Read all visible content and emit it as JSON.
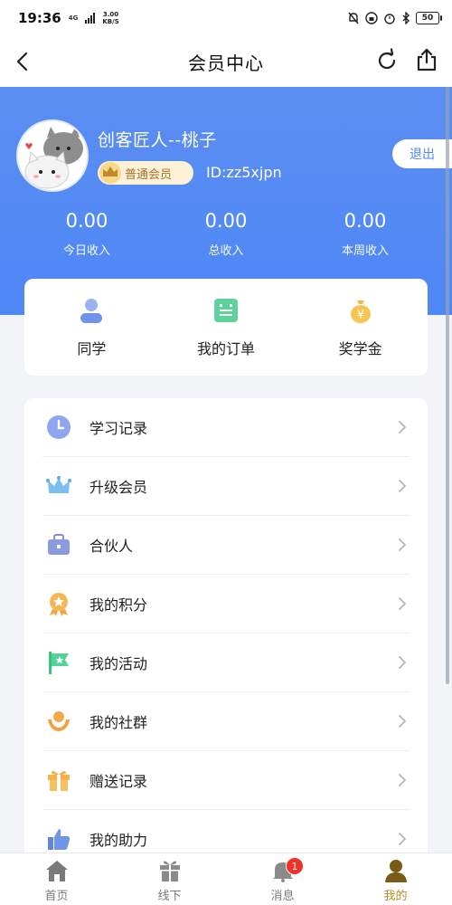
{
  "status_bar": {
    "time": "19:36",
    "network": "4G",
    "net_speed_value": "3.00",
    "net_speed_unit": "KB/S",
    "battery": "50"
  },
  "nav": {
    "title": "会员中心",
    "icons": [
      "back-icon",
      "refresh-icon",
      "share-icon"
    ]
  },
  "profile": {
    "name": "创客匠人--桃子",
    "member_level": "普通会员",
    "user_id": "ID:zz5xjpn",
    "logout_label": "退出"
  },
  "income": [
    {
      "value": "0.00",
      "label": "今日收入"
    },
    {
      "value": "0.00",
      "label": "总收入"
    },
    {
      "value": "0.00",
      "label": "本周收入"
    }
  ],
  "quick_actions": [
    {
      "label": "同学",
      "icon": "classmate-icon"
    },
    {
      "label": "我的订单",
      "icon": "order-icon"
    },
    {
      "label": "奖学金",
      "icon": "money-bag-icon"
    }
  ],
  "menu": [
    {
      "label": "学习记录",
      "icon": "clock-icon"
    },
    {
      "label": "升级会员",
      "icon": "crown-icon"
    },
    {
      "label": "合伙人",
      "icon": "briefcase-icon"
    },
    {
      "label": "我的积分",
      "icon": "medal-icon"
    },
    {
      "label": "我的活动",
      "icon": "flag-icon"
    },
    {
      "label": "我的社群",
      "icon": "community-icon"
    },
    {
      "label": "赠送记录",
      "icon": "gift-icon"
    },
    {
      "label": "我的助力",
      "icon": "thumbs-up-icon"
    }
  ],
  "tabs": [
    {
      "label": "首页",
      "icon": "home-icon"
    },
    {
      "label": "线下",
      "icon": "gift-box-icon"
    },
    {
      "label": "消息",
      "icon": "bell-icon",
      "badge": "1"
    },
    {
      "label": "我的",
      "icon": "user-icon",
      "active": true
    }
  ],
  "colors": {
    "header_blue": "#4f87f6",
    "accent_gold": "#b98f27",
    "badge_red": "#f2302a"
  }
}
